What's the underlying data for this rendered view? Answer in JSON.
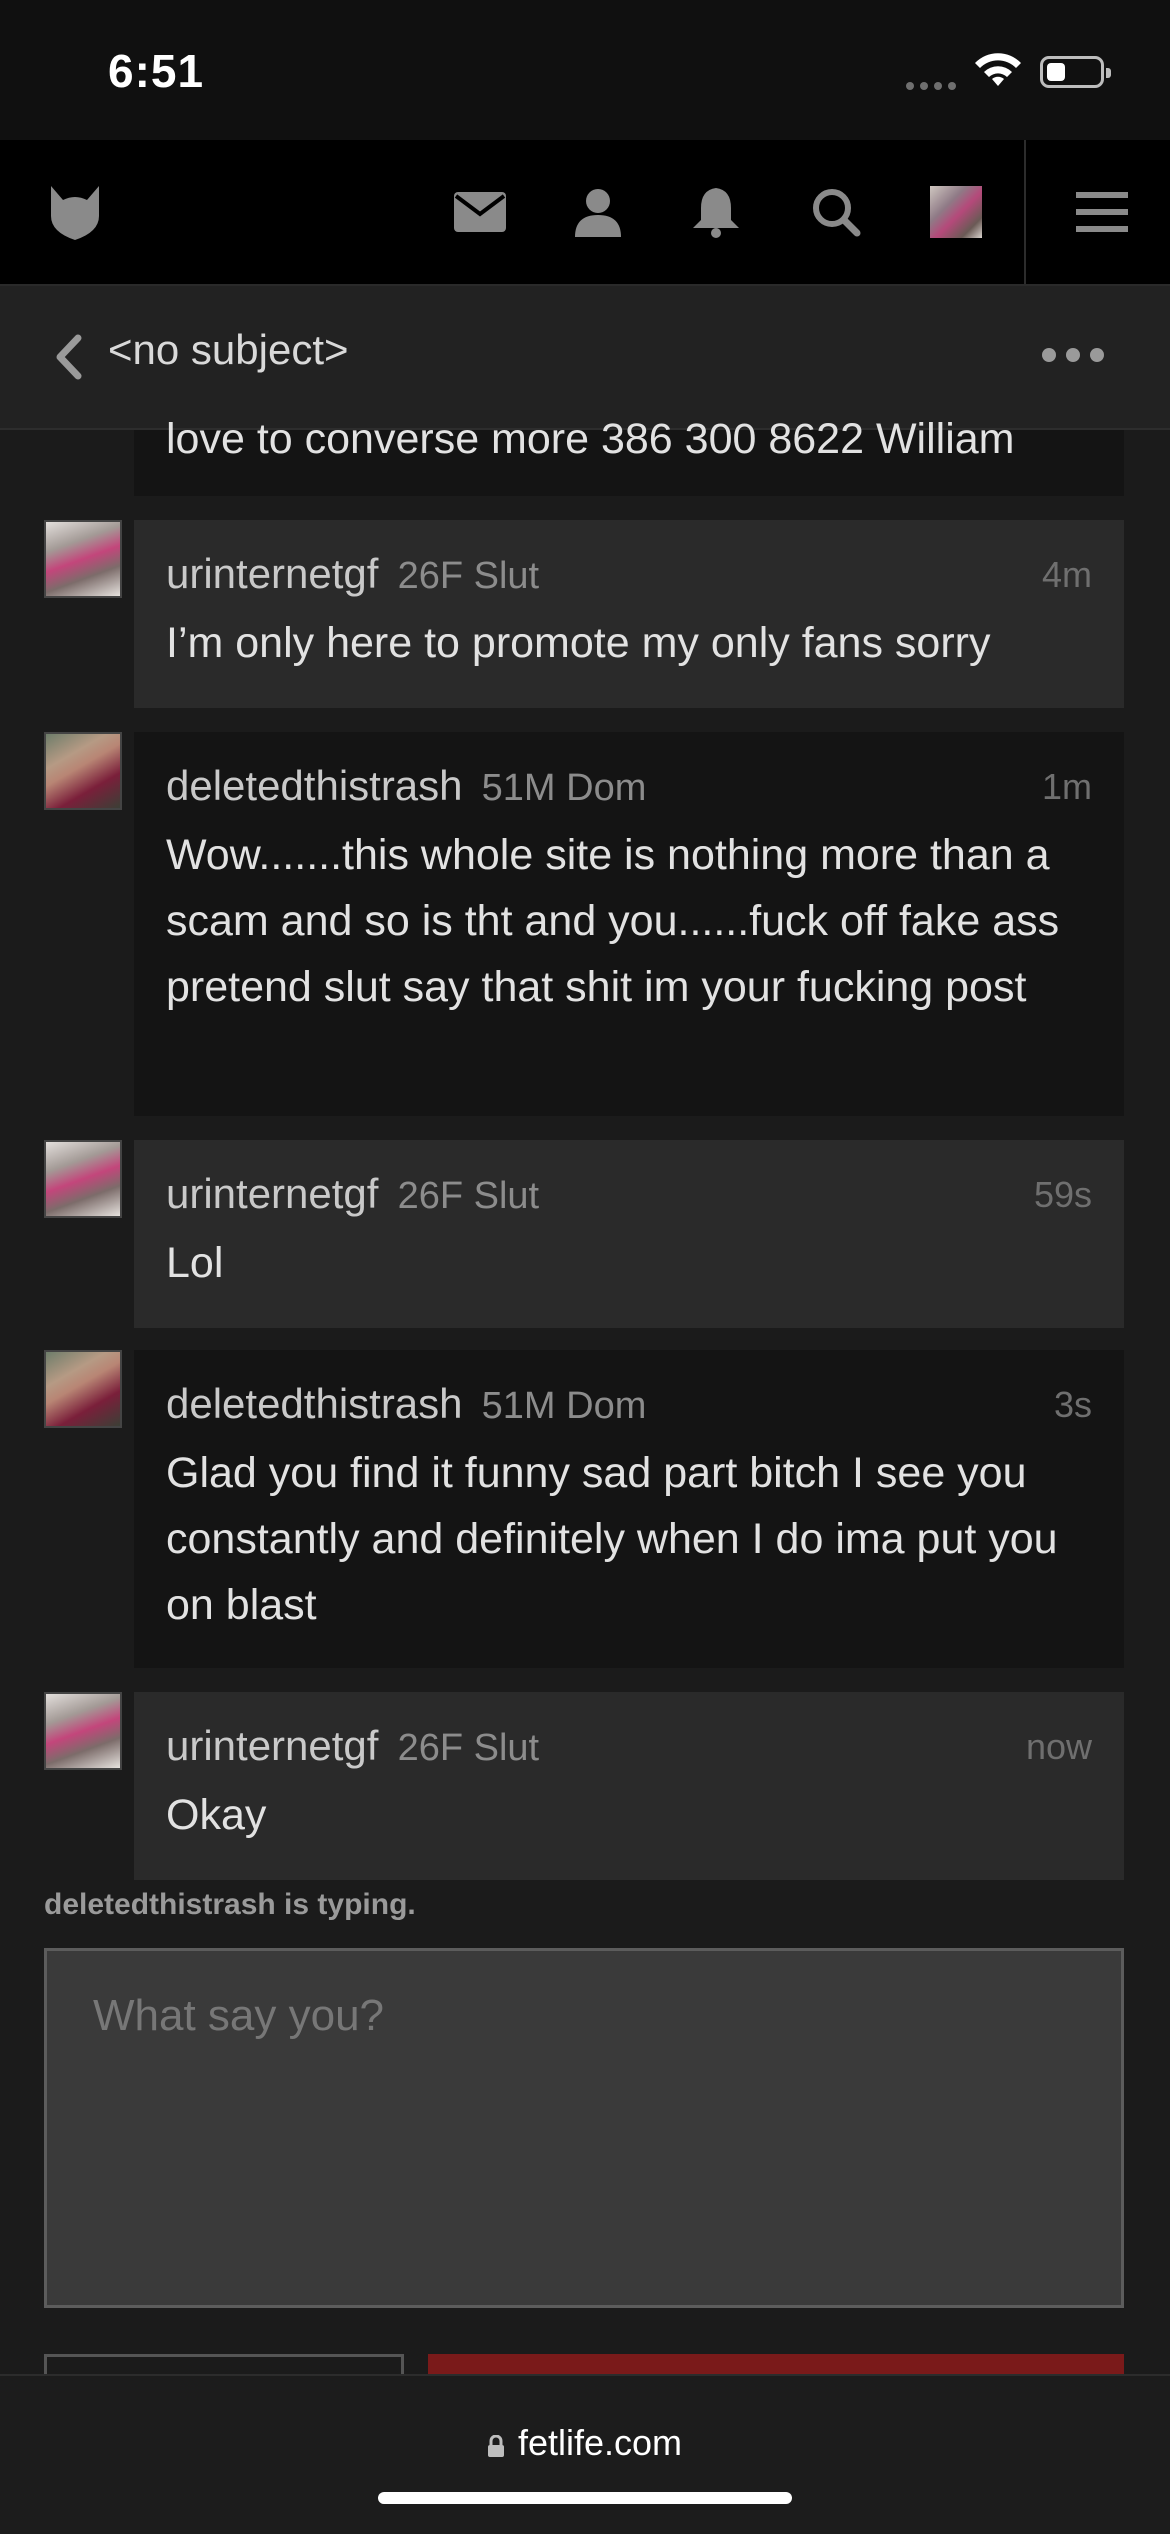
{
  "status_bar": {
    "time": "6:51"
  },
  "nav": {
    "items": [
      "logo",
      "mail",
      "profile",
      "notifications",
      "search",
      "avatar",
      "menu"
    ]
  },
  "conversation": {
    "title": "<no subject>"
  },
  "messages": [
    {
      "username": "",
      "tag": "",
      "time": "",
      "body": "love to converse more 386 300 8622 William",
      "theme": "dark"
    },
    {
      "username": "urinternetgf",
      "tag": "26F Slut",
      "time": "4m",
      "body": "I’m only here to promote my only fans sorry",
      "theme": "light"
    },
    {
      "username": "deletedthistrash",
      "tag": "51M Dom",
      "time": "1m",
      "body": "Wow.......this whole site is nothing more than a scam and so is tht and you......fuck off fake ass pretend slut say that shit im your fucking post",
      "theme": "dark"
    },
    {
      "username": "urinternetgf",
      "tag": "26F Slut",
      "time": "59s",
      "body": "Lol",
      "theme": "light"
    },
    {
      "username": "deletedthistrash",
      "tag": "51M Dom",
      "time": "3s",
      "body": "Glad you find it funny sad part bitch I see you constantly and definitely when I do ima put you on blast",
      "theme": "dark"
    },
    {
      "username": "urinternetgf",
      "tag": "26F Slut",
      "time": "now",
      "body": "Okay",
      "theme": "light"
    }
  ],
  "typing_indicator": "deletedthistrash is typing.",
  "compose": {
    "placeholder": "What say you?",
    "value": ""
  },
  "browser": {
    "url": "fetlife.com"
  },
  "colors": {
    "accent_red": "#7a1a1a",
    "background": "#1b1b1b",
    "nav_bg": "#000000"
  }
}
